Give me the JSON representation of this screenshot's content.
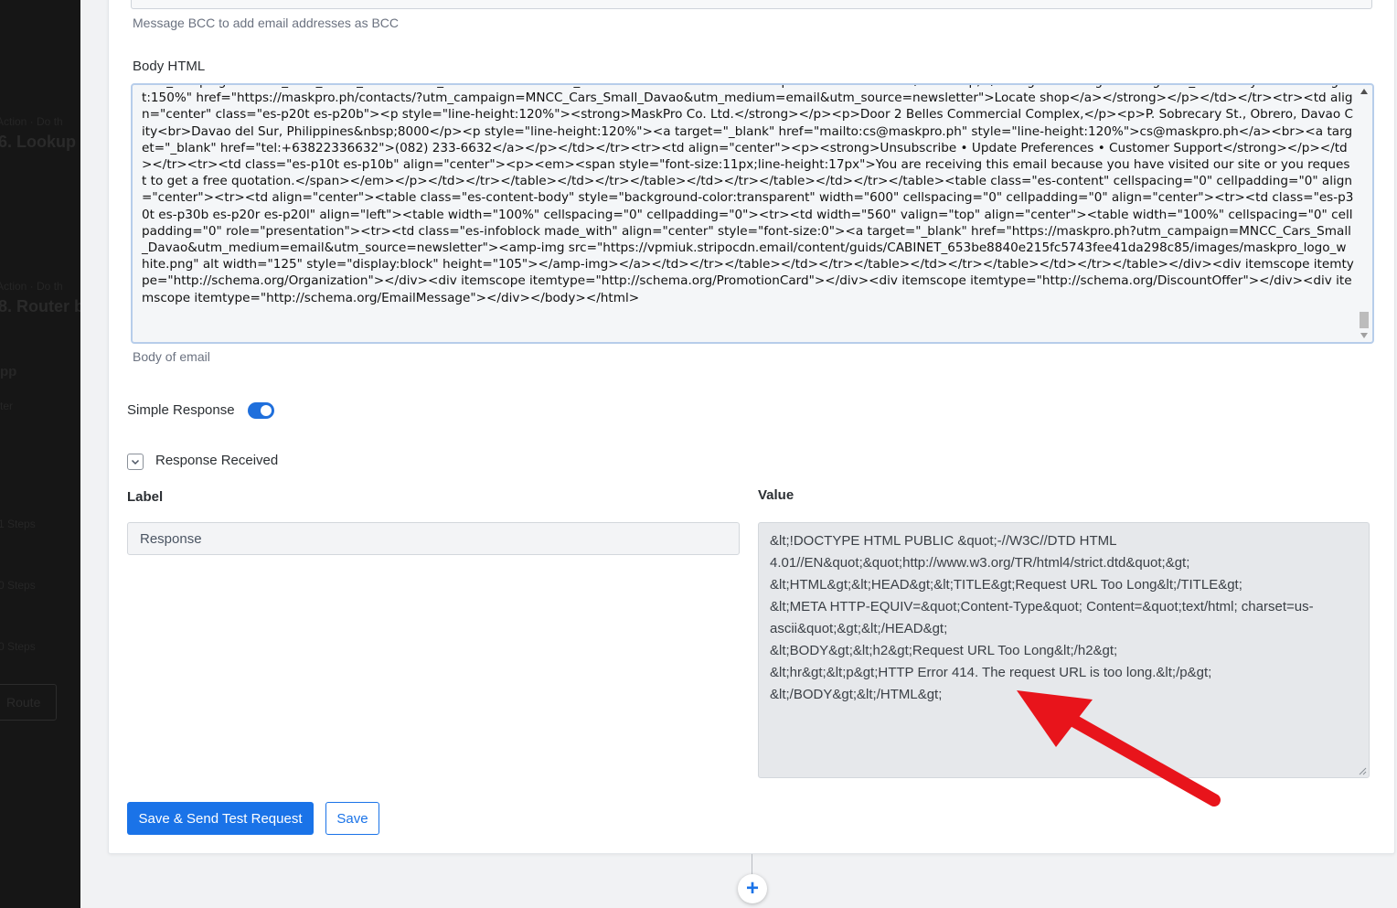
{
  "background_steps": {
    "step6_action": "Action · Do th",
    "step6_title": "6. Lookup",
    "step8_action": "Action · Do th",
    "step8_title": "8. Router b",
    "app_label": "pp",
    "filter_label": "ter",
    "steps_1": "1 Steps",
    "steps_2": "0 Steps",
    "steps_3": "0 Steps",
    "route_button": "Route"
  },
  "bcc": {
    "hint": "Message BCC to add email addresses as BCC"
  },
  "body_html": {
    "label": "Body HTML",
    "value": "utm_campaign=MNCC_Cars_Small_Davao&utm_medium=email&utm_source=newsletter\">Browse all products & services</a>&nbsp;</strong>•<strong><a target=\"_blank\" style=\"line-height:150%\" href=\"https://maskpro.ph/contacts/?utm_campaign=MNCC_Cars_Small_Davao&utm_medium=email&utm_source=newsletter\">Locate shop</a></strong></p></td></tr><tr><td align=\"center\" class=\"es-p20t es-p20b\"><p style=\"line-height:120%\"><strong>MaskPro Co. Ltd.</strong></p><p>Door 2 Belles Commercial Complex,</p><p>P. Sobrecary St., Obrero, Davao City<br>Davao del Sur, Philippines&nbsp;8000</p><p style=\"line-height:120%\"><a target=\"_blank\" href=\"mailto:cs@maskpro.ph\" style=\"line-height:120%\">cs@maskpro.ph</a><br><a target=\"_blank\" href=\"tel:+63822336632\">(082) 233-6632</a></p></td></tr><tr><td align=\"center\"><p><strong>Unsubscribe • Update Preferences • Customer Support</strong></p></td></tr><tr><td class=\"es-p10t es-p10b\" align=\"center\"><p><em><span style=\"font-size:11px;line-height:17px\">You are receiving this email because you have visited our site or you request to get a free quotation.</span></em></p></td></tr></table></td></tr></table></td></tr></table></td></tr></table><table class=\"es-content\" cellspacing=\"0\" cellpadding=\"0\" align=\"center\"><tr><td align=\"center\"><table class=\"es-content-body\" style=\"background-color:transparent\" width=\"600\" cellspacing=\"0\" cellpadding=\"0\" align=\"center\"><tr><td class=\"es-p30t es-p30b es-p20r es-p20l\" align=\"left\"><table width=\"100%\" cellspacing=\"0\" cellpadding=\"0\"><tr><td width=\"560\" valign=\"top\" align=\"center\"><table width=\"100%\" cellspacing=\"0\" cellpadding=\"0\" role=\"presentation\"><tr><td class=\"es-infoblock made_with\" align=\"center\" style=\"font-size:0\"><a target=\"_blank\" href=\"https://maskpro.ph?utm_campaign=MNCC_Cars_Small_Davao&utm_medium=email&utm_source=newsletter\"><amp-img src=\"https://vpmiuk.stripocdn.email/content/guids/CABINET_653be8840e215fc5743fee41da298c85/images/maskpro_logo_white.png\" alt width=\"125\" style=\"display:block\" height=\"105\"></amp-img></a></td></tr></table></td></tr></table></td></tr></table></td></tr></table></div><div itemscope itemtype=\"http://schema.org/Organization\"></div><div itemscope itemtype=\"http://schema.org/PromotionCard\"></div><div itemscope itemtype=\"http://schema.org/DiscountOffer\"></div><div itemscope itemtype=\"http://schema.org/EmailMessage\"></div></body></html>",
    "hint": "Body of email"
  },
  "simple_response": {
    "label": "Simple Response",
    "enabled": true
  },
  "response_received": {
    "label": "Response Received",
    "label_header": "Label",
    "value_header": "Value",
    "label_value": "Response",
    "value": "&lt;!DOCTYPE HTML PUBLIC &quot;-//W3C//DTD HTML 4.01//EN&quot;&quot;http://www.w3.org/TR/html4/strict.dtd&quot;&gt;\n&lt;HTML&gt;&lt;HEAD&gt;&lt;TITLE&gt;Request URL Too Long&lt;/TITLE&gt;\n&lt;META HTTP-EQUIV=&quot;Content-Type&quot; Content=&quot;text/html; charset=us-ascii&quot;&gt;&lt;/HEAD&gt;\n&lt;BODY&gt;&lt;h2&gt;Request URL Too Long&lt;/h2&gt;\n&lt;hr&gt;&lt;p&gt;HTTP Error 414. The request URL is too long.&lt;/p&gt;\n&lt;/BODY&gt;&lt;/HTML&gt;"
  },
  "buttons": {
    "save_send": "Save & Send Test Request",
    "save": "Save"
  },
  "add_step_symbol": "+",
  "colors": {
    "primary": "#1a73e8",
    "annotation_arrow": "#e8141b"
  }
}
